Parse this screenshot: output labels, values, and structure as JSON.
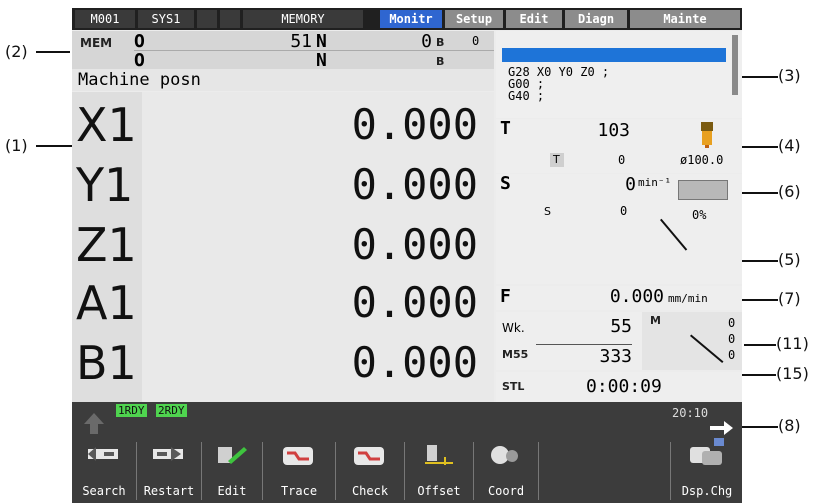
{
  "callouts": [
    "(2)",
    "(1)",
    "(3)",
    "(4)",
    "(6)",
    "(5)",
    "(7)",
    "(11)",
    "(15)",
    "(8)"
  ],
  "topbar": {
    "items": [
      "M001",
      "SYS1",
      "MEMORY"
    ],
    "tabs": [
      {
        "label": "Monitr",
        "active": true
      },
      {
        "label": "Setup",
        "active": false
      },
      {
        "label": "Edit",
        "active": false
      },
      {
        "label": "Diagn",
        "active": false
      },
      {
        "label": "Mainte",
        "active": false
      }
    ]
  },
  "status": {
    "mode": "MEM",
    "row1": {
      "o_label": "O",
      "o_value": "51",
      "n_label": "N",
      "n_value": "0",
      "b_label": "B",
      "b_value": "0"
    },
    "row2": {
      "o_label": "O",
      "n_label": "N",
      "b_label": "B"
    }
  },
  "program": {
    "lines": [
      "G28 X0 Y0 Z0 ;",
      "G00 ;",
      "G40 ;"
    ]
  },
  "position": {
    "title": "Machine posn",
    "axes": [
      {
        "name": "X1",
        "value": "0.000"
      },
      {
        "name": "Y1",
        "value": "0.000"
      },
      {
        "name": "Z1",
        "value": "0.000"
      },
      {
        "name": "A1",
        "value": "0.000"
      },
      {
        "name": "B1",
        "value": "0.000"
      }
    ]
  },
  "tool": {
    "label": "T",
    "value": "103",
    "sub_label": "T",
    "sub_value": "0",
    "diameter": "ø100.0"
  },
  "spindle": {
    "label": "S",
    "value": "0",
    "unit": "min⁻¹",
    "sub_label": "S",
    "sub_value": "0",
    "load": "0%",
    "load_fraction": 0
  },
  "feed": {
    "label": "F",
    "value": "0.000",
    "unit": "mm/min"
  },
  "work": {
    "label": "Wk.",
    "value": "55",
    "m_label": "M55",
    "m_value": "333",
    "m_header": "M",
    "m_values": [
      "0",
      "0",
      "0"
    ]
  },
  "cycle": {
    "label": "STL",
    "time": "0:00:09"
  },
  "footer": {
    "rdy": [
      "1RDY",
      "2RDY"
    ],
    "clock": "20:10",
    "softkeys": [
      "Search",
      "Restart",
      "Edit",
      "Trace",
      "Check",
      "Offset",
      "Coord",
      "Dsp.Chg"
    ]
  }
}
